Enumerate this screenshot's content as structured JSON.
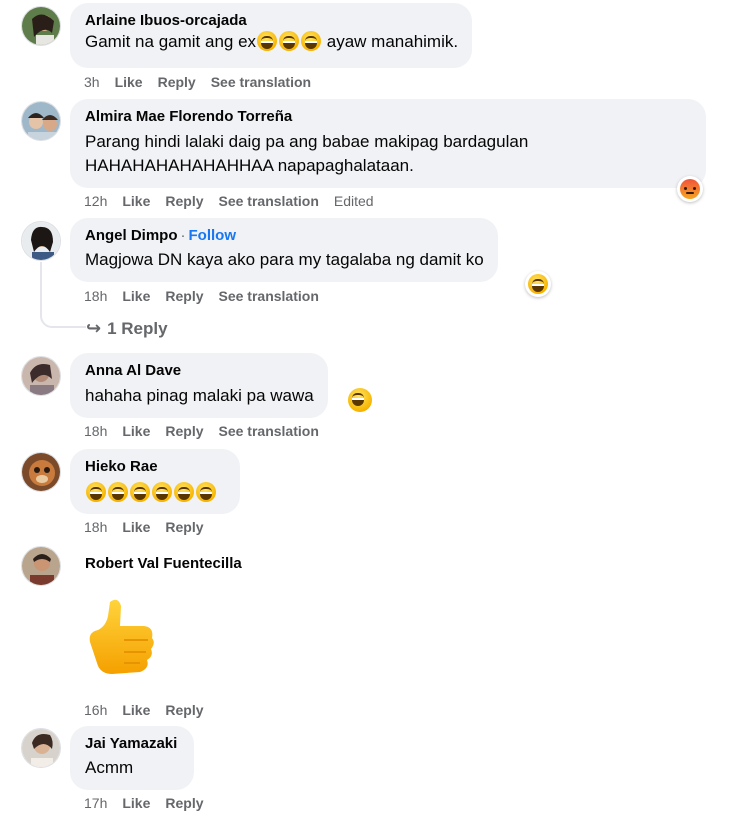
{
  "comments": [
    {
      "author": "Arlaine Ibuos-orcajada",
      "text_before": "Gamit na gamit ang ex",
      "text_after": " ayaw manahimik.",
      "time": "3h",
      "like": "Like",
      "reply": "Reply",
      "translate": "See translation"
    },
    {
      "author": "Almira Mae Florendo Torreña",
      "line1": "Parang hindi lalaki daig pa ang babae makipag bardagulan",
      "line2": "HAHAHAHAHAHAHHAA napapaghalataan.",
      "time": "12h",
      "like": "Like",
      "reply": "Reply",
      "translate": "See translation",
      "edited": "Edited",
      "reaction": "angry-icon"
    },
    {
      "author": "Angel Dimpo",
      "follow": "Follow",
      "text": "Magjowa DN kaya ako para my tagalaba ng damit ko",
      "time": "18h",
      "like": "Like",
      "reply": "Reply",
      "translate": "See translation",
      "reaction": "laughing-icon",
      "replies": "1 Reply"
    },
    {
      "author": "Anna Al Dave",
      "text": "hahaha pinag malaki pa wawa",
      "time": "18h",
      "like": "Like",
      "reply": "Reply",
      "translate": "See translation"
    },
    {
      "author": "Hieko Rae",
      "time": "18h",
      "like": "Like",
      "reply": "Reply"
    },
    {
      "author": "Robert Val Fuentecilla",
      "sticker": "thumbs-up",
      "time": "16h",
      "like": "Like",
      "reply": "Reply"
    },
    {
      "author": "Jai Yamazaki",
      "text": "Acmm",
      "time": "17h",
      "like": "Like",
      "reply": "Reply"
    }
  ],
  "colors": {
    "bubble": "#f0f2f5",
    "meta": "#65676b",
    "link": "#1877f2"
  }
}
